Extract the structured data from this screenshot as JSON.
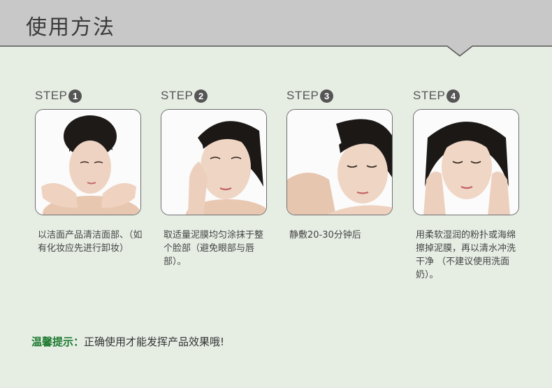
{
  "header": {
    "title": "使用方法"
  },
  "steps": [
    {
      "label": "STEP",
      "number": "1",
      "image": "woman-splashing-water-face-photo",
      "description": "以洁面产品清洁面部、（如有化妆应先进行卸妆）"
    },
    {
      "label": "STEP",
      "number": "2",
      "image": "woman-applying-mask-photo",
      "description": "取适量泥膜均匀涂抹于整个脸部（避免眼部与唇部）。"
    },
    {
      "label": "STEP",
      "number": "3",
      "image": "woman-resting-eyes-closed-photo",
      "description": "静敷20-30分钟后"
    },
    {
      "label": "STEP",
      "number": "4",
      "image": "woman-touching-face-photo",
      "description": "用柔软湿润的粉扑或海绵擦掉泥膜，再以清水冲洗干净 （不建议使用洗面奶）。"
    }
  ],
  "tip": {
    "label": "温馨提示：",
    "text": "正确使用才能发挥产品效果哦!"
  },
  "colors": {
    "header_bg": "#c9c9c9",
    "page_bg": "#e6eee4",
    "tip_label": "#1f7a31",
    "badge": "#555555"
  }
}
